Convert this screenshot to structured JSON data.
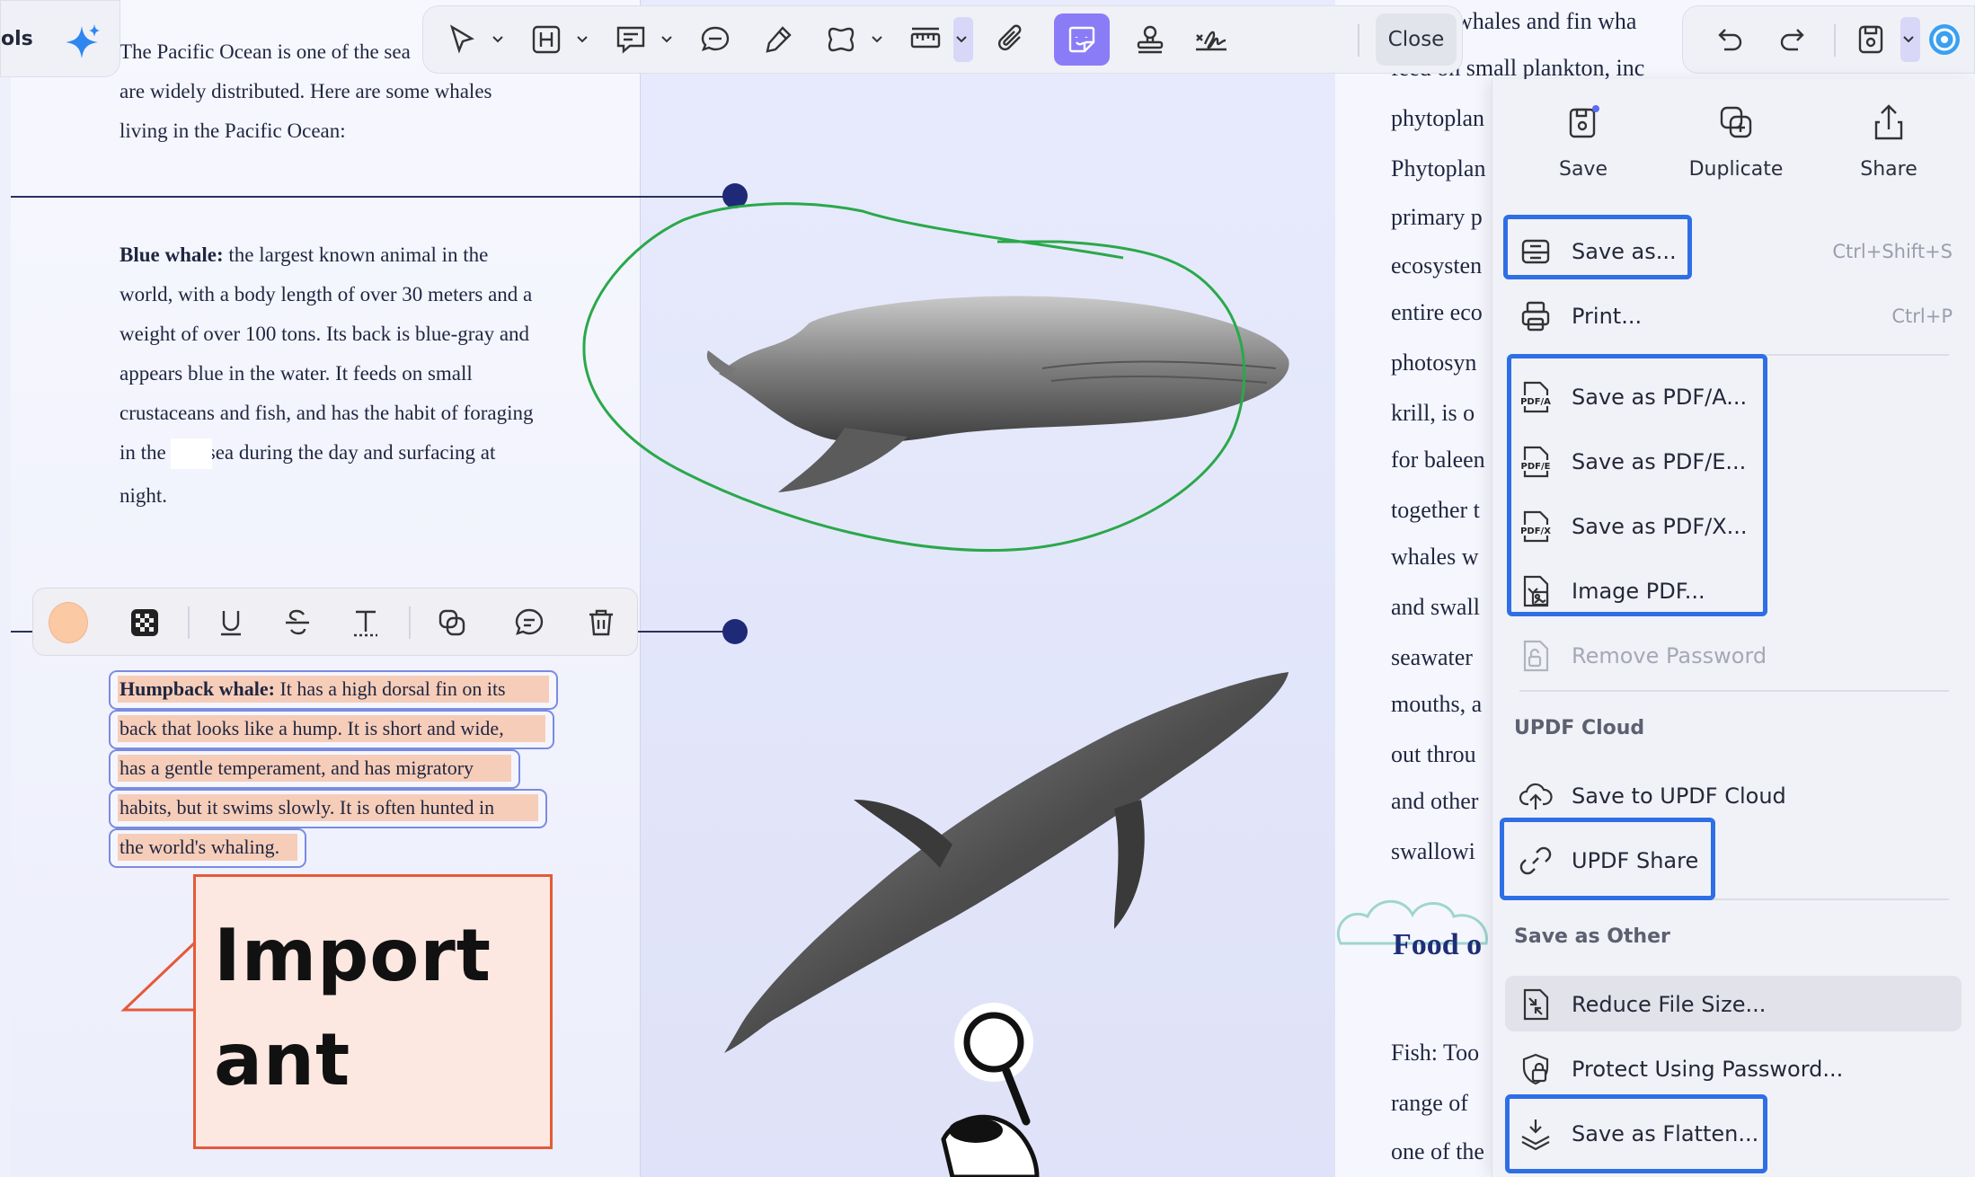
{
  "toolbar": {
    "tools_label": "ols",
    "close_label": "Close"
  },
  "left_page": {
    "intro": [
      "The Pacific Ocean is one of the sea",
      "are widely distributed. Here are some whales",
      "living in the Pacific Ocean:"
    ],
    "blue_whale_title": "Blue whale:",
    "blue_whale_lines": [
      " the largest known animal in the",
      "world, with a body length of over 30 meters and a",
      "weight of over 100 tons. Its back is blue-gray and",
      "appears blue in the water. It feeds on small",
      "crustaceans and fish, and has the habit of foraging",
      "in the        sea during the day and surfacing at",
      "night."
    ],
    "humpback_title": "Humpback whale:",
    "humpback_lines": [
      " It has a high dorsal fin on its",
      "back that looks like a hump. It is short and wide,",
      "has a gentle temperament, and has migratory",
      "habits, but it swims slowly. It is often hunted in",
      "the world's whaling."
    ]
  },
  "sticky_note": {
    "text_line1": "Import",
    "text_line2": "ant"
  },
  "right_page": {
    "lines": [
      "whales and fin wha",
      "feed on small plankton, inc",
      "phytoplan",
      "Phytoplan",
      "primary p",
      "ecosysten",
      "entire eco",
      "photosyn",
      "krill, is o",
      "for baleen",
      "together t",
      "whales w",
      "and swall",
      "seawater",
      "mouths, a",
      "out throu",
      "and other",
      "swallowi"
    ],
    "heading": "Food o",
    "bottom_lines": [
      "Fish: Too",
      "range of",
      "one of the"
    ]
  },
  "menu": {
    "top_actions": [
      {
        "label": "Save",
        "icon": "save-icon"
      },
      {
        "label": "Duplicate",
        "icon": "duplicate-icon"
      },
      {
        "label": "Share",
        "icon": "share-icon"
      }
    ],
    "save_as": {
      "label": "Save as...",
      "shortcut": "Ctrl+Shift+S"
    },
    "print": {
      "label": "Print...",
      "shortcut": "Ctrl+P"
    },
    "pdfa": {
      "label": "Save as PDF/A..."
    },
    "pdfe": {
      "label": "Save as PDF/E..."
    },
    "pdfx": {
      "label": "Save as PDF/X..."
    },
    "image_pdf": {
      "label": "Image PDF..."
    },
    "remove_password": {
      "label": "Remove Password"
    },
    "cloud_section": "UPDF Cloud",
    "save_cloud": {
      "label": "Save to UPDF Cloud"
    },
    "updf_share": {
      "label": "UPDF Share"
    },
    "other_section": "Save as Other",
    "reduce": {
      "label": "Reduce File Size..."
    },
    "protect": {
      "label": "Protect Using Password..."
    },
    "flatten": {
      "label": "Save as Flatten..."
    }
  },
  "colors": {
    "accent": "#8a7cf6",
    "highlight_box": "#2f6fe6",
    "note_border": "#e45a3a",
    "ink_green": "#2aa84a",
    "picked_color": "#fbc9a3"
  }
}
